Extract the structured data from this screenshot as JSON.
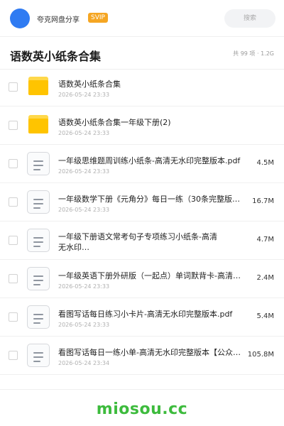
{
  "header": {
    "user_name": "夸克网盘分享",
    "badge": "SVIP",
    "search_placeholder": "搜索"
  },
  "folder": {
    "title": "语数英小纸条合集",
    "summary": "共 99 项 · 1.2G"
  },
  "files": [
    {
      "type": "folder",
      "name": "语数英小纸条合集",
      "date": "2026-05-24 23:33",
      "size": ""
    },
    {
      "type": "folder",
      "name": "语数英小纸条合集一年级下册(2)",
      "date": "2026-05-24 23:33",
      "size": ""
    },
    {
      "type": "file",
      "name": "一年级思维题周训练小纸条-高清无水印完整版本.pdf",
      "date": "2026-05-24 23:33",
      "size": "4.5M"
    },
    {
      "type": "file",
      "name": "一年级数学下册《元角分》每日一练（30条完整版）-…",
      "date": "2026-05-24 23:33",
      "size": "16.7M"
    },
    {
      "type": "file",
      "name": "一年级下册语文常考句子专项练习小纸条-高清无水印…",
      "date": "2026-05-24 23:33",
      "size": "4.7M"
    },
    {
      "type": "file",
      "name": "一年级英语下册外研版（一起点）单词默背卡-高清无水…",
      "date": "2026-05-24 23:33",
      "size": "2.4M"
    },
    {
      "type": "file",
      "name": "看图写话每日练习小卡片-高清无水印完整版本.pdf",
      "date": "2026-05-24 23:33",
      "size": "5.4M"
    },
    {
      "type": "file",
      "name": "看图写话每日一练小单-高清无水印完整版本【公众号：",
      "date": "2026-05-24 23:34",
      "size": "105.8M"
    }
  ],
  "watermark": "miosou.cc"
}
